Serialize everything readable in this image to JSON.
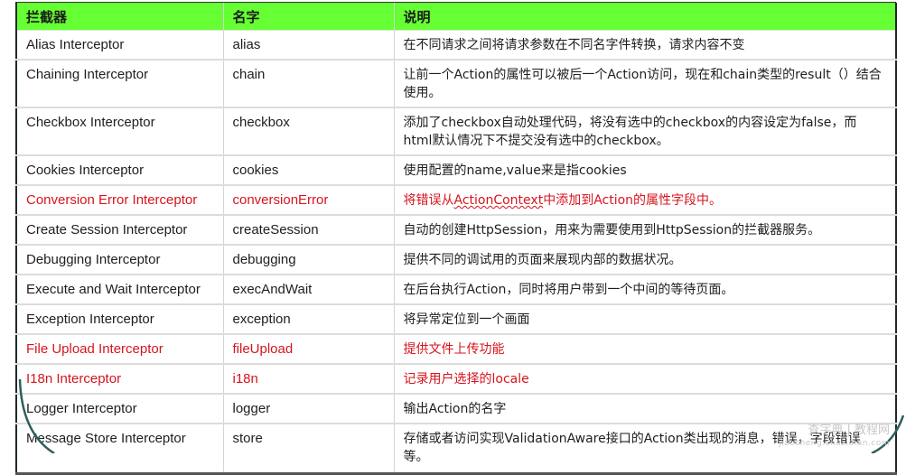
{
  "table": {
    "headers": [
      "拦截器",
      "名字",
      "说明"
    ],
    "highlight_color": "#d7141e",
    "header_color": "#66ff33",
    "rows": [
      {
        "interceptor": "Alias Interceptor",
        "name": "alias",
        "description": "在不同请求之间将请求参数在不同名字件转换，请求内容不变",
        "highlight": false
      },
      {
        "interceptor": "Chaining Interceptor",
        "name": "chain",
        "description": "让前一个Action的属性可以被后一个Action访问，现在和chain类型的result（）结合使用。",
        "highlight": false
      },
      {
        "interceptor": "Checkbox Interceptor",
        "name": "checkbox",
        "description": "添加了checkbox自动处理代码，将没有选中的checkbox的内容设定为false，而html默认情况下不提交没有选中的checkbox。",
        "highlight": false
      },
      {
        "interceptor": "Cookies Interceptor",
        "name": "cookies",
        "description": "使用配置的name,value来是指cookies",
        "highlight": false
      },
      {
        "interceptor": "Conversion Error Interceptor",
        "name": "conversionError",
        "description": "将错误从ActionContext中添加到Action的属性字段中。",
        "highlight": true
      },
      {
        "interceptor": "Create Session Interceptor",
        "name": "createSession",
        "description": "自动的创建HttpSession，用来为需要使用到HttpSession的拦截器服务。",
        "highlight": false
      },
      {
        "interceptor": "Debugging Interceptor",
        "name": "debugging",
        "description": "提供不同的调试用的页面来展现内部的数据状况。",
        "highlight": false
      },
      {
        "interceptor": "Execute and Wait Interceptor",
        "name": "execAndWait",
        "description": "在后台执行Action，同时将用户带到一个中间的等待页面。",
        "highlight": false
      },
      {
        "interceptor": "Exception Interceptor",
        "name": "exception",
        "description": "将异常定位到一个画面",
        "highlight": false
      },
      {
        "interceptor": "File Upload Interceptor",
        "name": "fileUpload",
        "description": "提供文件上传功能",
        "highlight": true
      },
      {
        "interceptor": "I18n Interceptor",
        "name": "i18n",
        "description": "记录用户选择的locale",
        "highlight": true
      },
      {
        "interceptor": "Logger Interceptor",
        "name": "logger",
        "description": "输出Action的名字",
        "highlight": false
      },
      {
        "interceptor": "Message Store Interceptor",
        "name": "store",
        "description": "存储或者访问实现ValidationAware接口的Action类出现的消息，错误，字段错误等。",
        "highlight": false
      }
    ]
  },
  "conversion_error_desc_parts": {
    "before": "将错误从",
    "underlined": "ActionContext",
    "after": "中添加到Action的属性字段中。"
  },
  "watermark": {
    "line1": "查字典 | 教程网",
    "line2": "jiaocheng.chazidian.com"
  }
}
